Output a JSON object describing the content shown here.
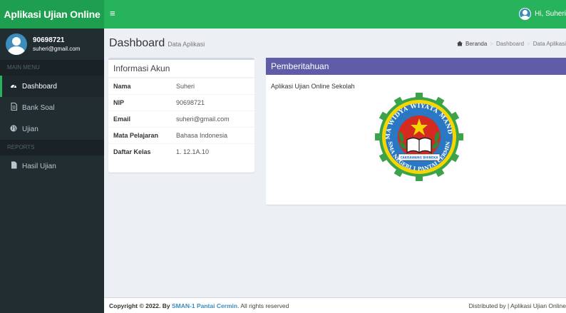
{
  "app": {
    "title": "Aplikasi Ujian Online"
  },
  "navbar": {
    "menu_toggle": "≡",
    "user_greeting": "Hi, Suheri"
  },
  "sidebar": {
    "user": {
      "name": "90698721",
      "email": "suheri@gmail.com"
    },
    "main_menu_header": "MAIN MENU",
    "items": [
      {
        "label": "Dashboard",
        "icon": "dashboard-icon"
      },
      {
        "label": "Bank Soal",
        "icon": "file-icon"
      },
      {
        "label": "Ujian",
        "icon": "globe-icon"
      }
    ],
    "reports_header": "REPORTS",
    "report_items": [
      {
        "label": "Hasil Ujian",
        "icon": "file-icon"
      }
    ]
  },
  "content_header": {
    "title": "Dashboard",
    "subtitle": "Data Aplikasi",
    "breadcrumb": [
      "Beranda",
      "Dashboard",
      "Data Aplikasi"
    ]
  },
  "akun": {
    "title": "Informasi Akun",
    "rows": [
      {
        "label": "Nama",
        "value": "Suheri"
      },
      {
        "label": "NIP",
        "value": "90698721"
      },
      {
        "label": "Email",
        "value": "suheri@gmail.com"
      },
      {
        "label": "Mata Pelajaran",
        "value": "Bahasa Indonesia"
      },
      {
        "label": "Daftar Kelas",
        "value": "1. 12.1A.10"
      }
    ]
  },
  "notif": {
    "title": "Pemberitahuan",
    "text": "Aplikasi Ujian Online Sekolah",
    "seal": {
      "top_text": "ATMA WIDYA WIYATA MANDALA",
      "ribbon_text": "CAKRAWANG BHINEKA",
      "bottom_text": "SMA NEGERI 1 PANTAI CERMIN"
    }
  },
  "footer": {
    "copyright_prefix": "Copyright © 2022. By",
    "copyright_link": "SMAN-1 Pantai Cermin",
    "copyright_suffix": ". All rights reserved",
    "distributed": "Distributed by | Aplikasi Ujian Online"
  },
  "colors": {
    "logo_bg": "#1e9f4f",
    "navbar_bg": "#27b35b",
    "sidebar_bg": "#222d32",
    "notif_header": "#605ca8",
    "link": "#3c8dbc"
  }
}
